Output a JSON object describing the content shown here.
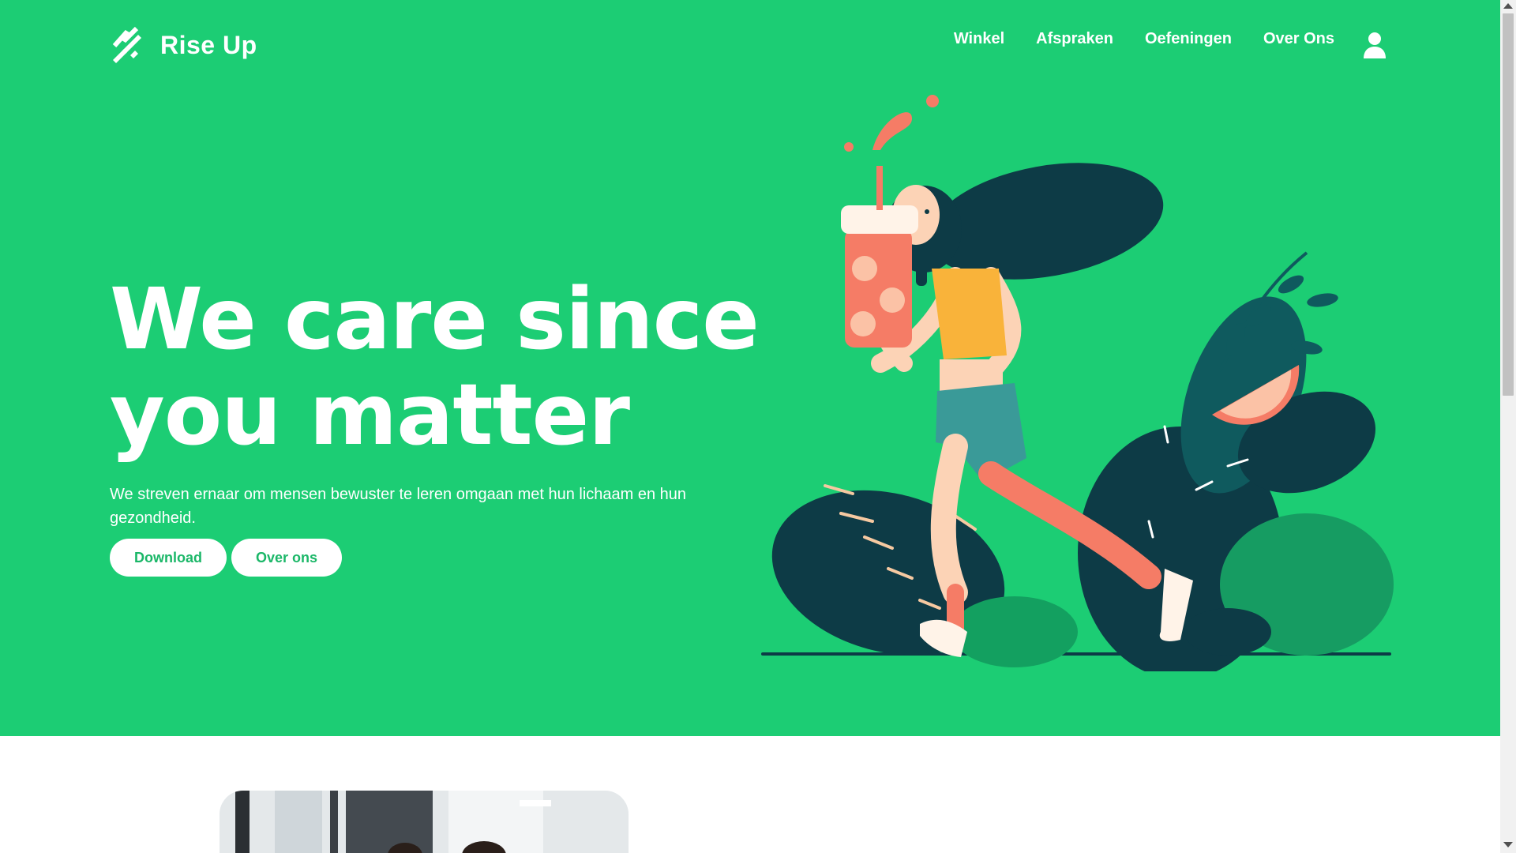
{
  "brand": {
    "name": "Rise Up",
    "logo_icon": "runner-arrow-icon"
  },
  "nav": {
    "items": [
      {
        "label": "Winkel"
      },
      {
        "label": "Afspraken"
      },
      {
        "label": "Oefeningen"
      },
      {
        "label": "Over Ons"
      }
    ],
    "account_icon": "user-icon"
  },
  "hero": {
    "headline_line1": "We care since",
    "headline_line2": "you matter",
    "subtitle": "We streven ernaar om mensen bewuster te leren omgaan met hun lichaam en hun gezondheid.",
    "buttons": {
      "download": "Download",
      "about": "Over ons"
    }
  },
  "colors": {
    "brand_green": "#1ccd74",
    "button_text": "#1bb768",
    "dark_teal": "#0d3b46",
    "orange": "#f9b33a",
    "coral": "#f57c66"
  }
}
